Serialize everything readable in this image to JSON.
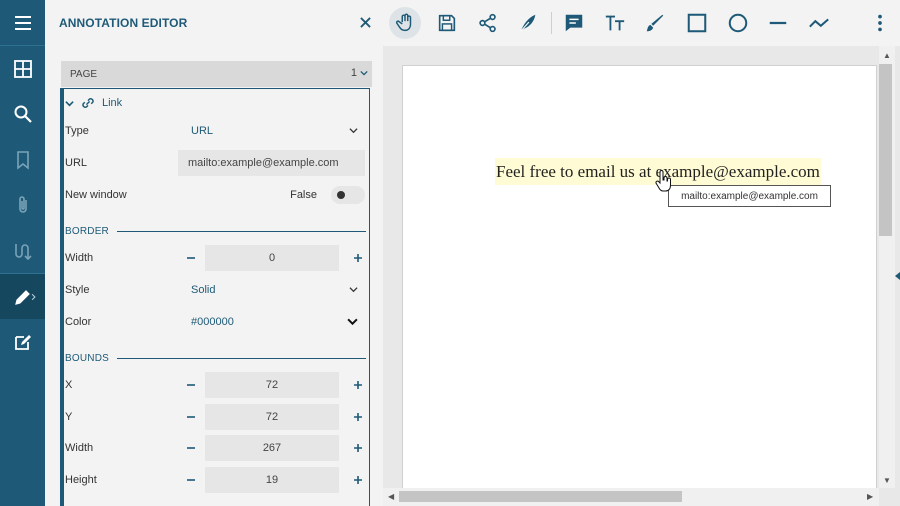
{
  "panel": {
    "title": "ANNOTATION EDITOR",
    "page_label": "PAGE",
    "page_number": "1",
    "annotation_type": "Link"
  },
  "props": {
    "type": {
      "label": "Type",
      "value": "URL"
    },
    "url": {
      "label": "URL",
      "value": "mailto:example@example.com"
    },
    "new_window": {
      "label": "New window",
      "value": "False"
    },
    "border_section": "BORDER",
    "border_width": {
      "label": "Width",
      "value": "0"
    },
    "style": {
      "label": "Style",
      "value": "Solid"
    },
    "color": {
      "label": "Color",
      "value": "#000000"
    },
    "bounds_section": "BOUNDS",
    "x": {
      "label": "X",
      "value": "72"
    },
    "y": {
      "label": "Y",
      "value": "72"
    },
    "width": {
      "label": "Width",
      "value": "267"
    },
    "height": {
      "label": "Height",
      "value": "19"
    }
  },
  "document": {
    "link_text": "Feel free to email us at example@example.com",
    "tooltip": "mailto:example@example.com"
  },
  "colors": {
    "rail": "#1e5a77",
    "accent": "#1e5a77",
    "link_highlight": "#fffbd4"
  },
  "icons": {
    "rail": [
      "menu-icon",
      "thumbnails-icon",
      "search-icon",
      "bookmark-icon",
      "attachment-icon",
      "structure-icon",
      "annotation-edit-icon",
      "form-edit-icon"
    ],
    "toolbar": [
      "pan-icon",
      "save-icon",
      "share-icon",
      "feather-icon",
      "comment-icon",
      "text-icon",
      "pen-icon",
      "square-icon",
      "circle-icon",
      "line-icon",
      "polyline-icon",
      "more-icon"
    ]
  }
}
